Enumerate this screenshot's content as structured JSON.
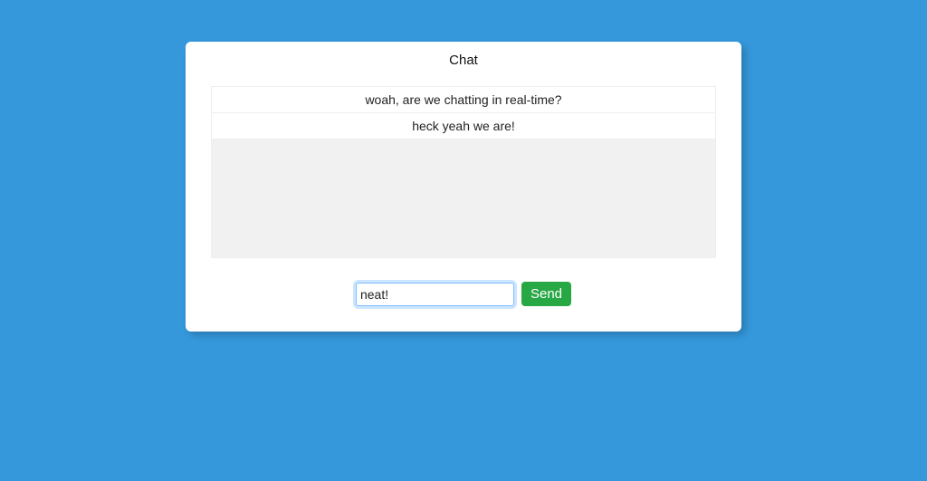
{
  "chat": {
    "title": "Chat",
    "messages": [
      "woah, are we chatting in real-time?",
      "heck yeah we are!"
    ],
    "input_value": "neat!",
    "send_label": "Send"
  }
}
